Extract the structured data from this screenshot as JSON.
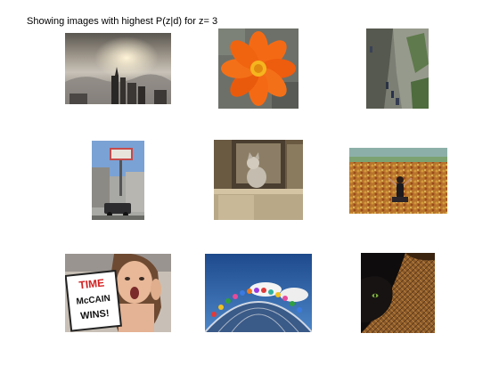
{
  "figure": {
    "title": "Showing images with highest P(z|d) for z= 3"
  },
  "images": [
    {
      "subject": "city skyline above fog at sunset"
    },
    {
      "subject": "orange cosmos flower"
    },
    {
      "subject": "people near rocky cliff"
    },
    {
      "subject": "street with billboard and parked car"
    },
    {
      "subject": "cat on wooden windowsill"
    },
    {
      "subject": "person in field of autumn leaves"
    },
    {
      "subject": "surprised woman holding McCain sign"
    },
    {
      "subject": "colorful figures on dome under blue sky"
    },
    {
      "subject": "black cat on wooden basket"
    }
  ],
  "sign_text": {
    "line1": "TIME",
    "line2": "McCAIN",
    "line3": "WINS!"
  }
}
